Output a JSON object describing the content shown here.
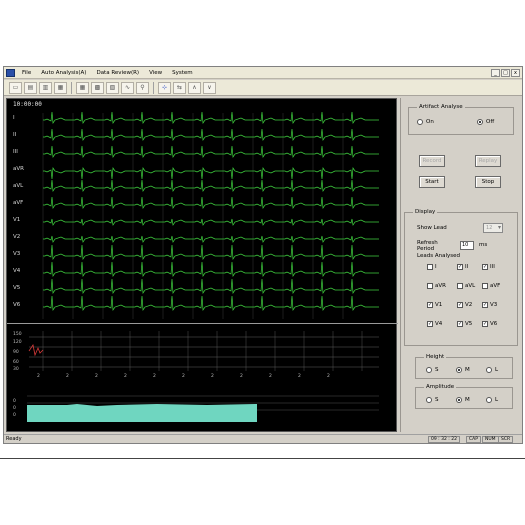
{
  "menu": {
    "items": [
      "File",
      "Auto Analysis(A)",
      "Data Review(R)",
      "View",
      "System"
    ]
  },
  "window_buttons": [
    "_",
    "□",
    "x"
  ],
  "toolbar": {
    "buttons": [
      {
        "icon": "new-doc-icon",
        "glyph": "▭"
      },
      {
        "icon": "open-icon",
        "glyph": "▤"
      },
      {
        "icon": "save-icon",
        "glyph": "▥"
      },
      {
        "icon": "print-icon",
        "glyph": "▦"
      },
      {
        "icon": "grid-icon",
        "glyph": "▦"
      },
      {
        "icon": "chart-icon",
        "glyph": "▩"
      },
      {
        "icon": "report-icon",
        "glyph": "▧"
      },
      {
        "icon": "wave-icon",
        "glyph": "∿"
      },
      {
        "icon": "filter-icon",
        "glyph": "⚲"
      },
      {
        "icon": "measure-icon",
        "glyph": "⊹"
      },
      {
        "icon": "scale-icon",
        "glyph": "⇆"
      },
      {
        "icon": "zoom-in-icon",
        "glyph": "∧"
      },
      {
        "icon": "zoom-out-icon",
        "glyph": "∨"
      }
    ]
  },
  "monitor": {
    "clock": "10:00:00",
    "leads": [
      "I",
      "II",
      "III",
      "aVR",
      "aVL",
      "aVF",
      "V1",
      "V2",
      "V3",
      "V4",
      "V5",
      "V6"
    ],
    "trend_axis_labels": [
      "150",
      "120",
      "90",
      "60",
      "30"
    ],
    "trend_times": [
      "2",
      "2",
      "2",
      "2",
      "2",
      "2",
      "2",
      "2",
      "2",
      "2",
      "2"
    ],
    "lower_axis_labels": [
      "0",
      "0",
      "0"
    ],
    "trace_color": "#3fd13f",
    "bar_color": "#6fd6c0"
  },
  "panel": {
    "artifact": {
      "title": "Artifact Analyse",
      "on_label": "On",
      "off_label": "Off",
      "selected": "Off"
    },
    "buttons": {
      "record": "Record",
      "replay": "Replay",
      "start": "Start",
      "stop": "Stop"
    },
    "display": {
      "title": "Display",
      "show_lead_label": "Show Lead",
      "show_lead_value": "12",
      "refresh_label": "Refresh",
      "refresh_sub": "Period",
      "refresh_value": "10",
      "refresh_unit": "ms",
      "leads_analysed_label": "Leads Analysed",
      "leads": [
        {
          "name": "I",
          "checked": false
        },
        {
          "name": "II",
          "checked": true
        },
        {
          "name": "III",
          "checked": true
        },
        {
          "name": "aVR",
          "checked": false
        },
        {
          "name": "aVL",
          "checked": false
        },
        {
          "name": "aVF",
          "checked": false
        },
        {
          "name": "V1",
          "checked": true
        },
        {
          "name": "V2",
          "checked": true
        },
        {
          "name": "V3",
          "checked": true
        },
        {
          "name": "V4",
          "checked": true
        },
        {
          "name": "V5",
          "checked": true
        },
        {
          "name": "V6",
          "checked": true
        }
      ]
    },
    "height": {
      "title": "Height",
      "options": [
        "S",
        "M",
        "L"
      ],
      "selected": "M"
    },
    "amplitude": {
      "title": "Amplitude",
      "options": [
        "S",
        "M",
        "L"
      ],
      "selected": "M"
    }
  },
  "status": {
    "ready": "Ready",
    "cells": [
      "09 : 32 : 22",
      "CAP",
      "NUM",
      "SCR"
    ]
  }
}
